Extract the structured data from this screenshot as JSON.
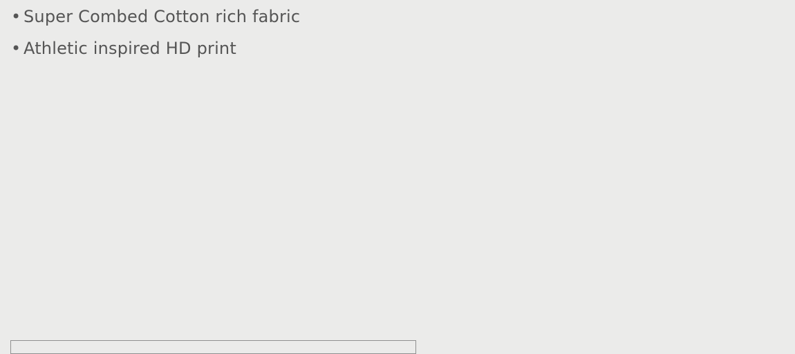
{
  "product_details": {
    "features": [
      {
        "text": "Super Combed Cotton rich fabric",
        "bullet": "•"
      },
      {
        "text": "Athletic inspired HD print",
        "bullet": "•"
      }
    ]
  },
  "colors": {
    "background": "#ebebea",
    "text": "#555555",
    "border": "#8f8f8f"
  }
}
